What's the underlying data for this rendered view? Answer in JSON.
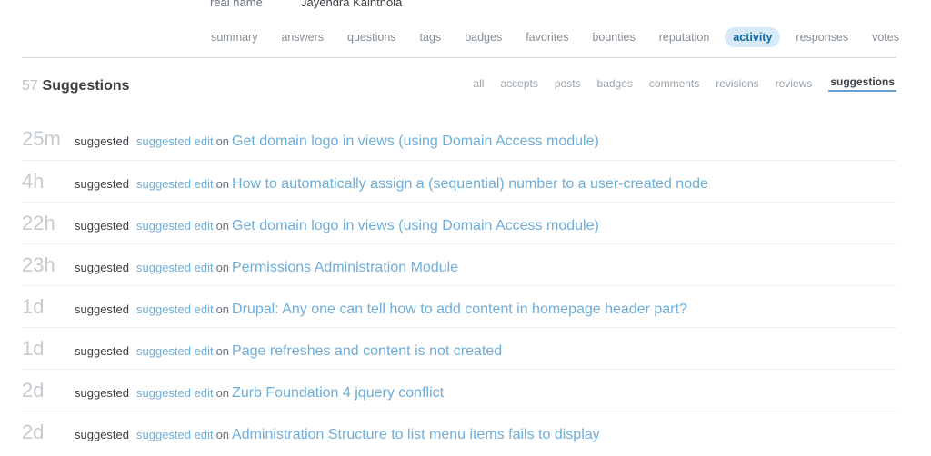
{
  "profile": {
    "field_label": "real name",
    "field_value": "Jayendra Kainthola"
  },
  "nav": {
    "tabs": [
      {
        "label": "summary",
        "selected": false
      },
      {
        "label": "answers",
        "selected": false
      },
      {
        "label": "questions",
        "selected": false
      },
      {
        "label": "tags",
        "selected": false
      },
      {
        "label": "badges",
        "selected": false
      },
      {
        "label": "favorites",
        "selected": false
      },
      {
        "label": "bounties",
        "selected": false
      },
      {
        "label": "reputation",
        "selected": false
      },
      {
        "label": "activity",
        "selected": true
      },
      {
        "label": "responses",
        "selected": false
      },
      {
        "label": "votes",
        "selected": false
      }
    ],
    "selected_color": "#15699e",
    "selected_bg": "#d7eaf7"
  },
  "section": {
    "count": "57",
    "title": "Suggestions",
    "sub_tabs": [
      {
        "label": "all",
        "selected": false
      },
      {
        "label": "accepts",
        "selected": false
      },
      {
        "label": "posts",
        "selected": false
      },
      {
        "label": "badges",
        "selected": false
      },
      {
        "label": "comments",
        "selected": false
      },
      {
        "label": "revisions",
        "selected": false
      },
      {
        "label": "reviews",
        "selected": false
      },
      {
        "label": "suggestions",
        "selected": true
      }
    ],
    "underline_color": "#6a9fd4"
  },
  "activity": {
    "link_color": "#6eadd8",
    "time_color": "#c6cbd0",
    "rows": [
      {
        "time": "25m",
        "verb": "suggested",
        "edit_link": "suggested edit",
        "on": "on",
        "post": "Get domain logo in views (using Domain Access module)"
      },
      {
        "time": "4h",
        "verb": "suggested",
        "edit_link": "suggested edit",
        "on": "on",
        "post": "How to automatically assign a (sequential) number to a user-created node"
      },
      {
        "time": "22h",
        "verb": "suggested",
        "edit_link": "suggested edit",
        "on": "on",
        "post": "Get domain logo in views (using Domain Access module)"
      },
      {
        "time": "23h",
        "verb": "suggested",
        "edit_link": "suggested edit",
        "on": "on",
        "post": "Permissions Administration Module"
      },
      {
        "time": "1d",
        "verb": "suggested",
        "edit_link": "suggested edit",
        "on": "on",
        "post": "Drupal: Any one can tell how to add content in homepage header part?"
      },
      {
        "time": "1d",
        "verb": "suggested",
        "edit_link": "suggested edit",
        "on": "on",
        "post": "Page refreshes and content is not created"
      },
      {
        "time": "2d",
        "verb": "suggested",
        "edit_link": "suggested edit",
        "on": "on",
        "post": "Zurb Foundation 4 jquery conflict"
      },
      {
        "time": "2d",
        "verb": "suggested",
        "edit_link": "suggested edit",
        "on": "on",
        "post": "Administration Structure to list menu items fails to display"
      }
    ]
  }
}
